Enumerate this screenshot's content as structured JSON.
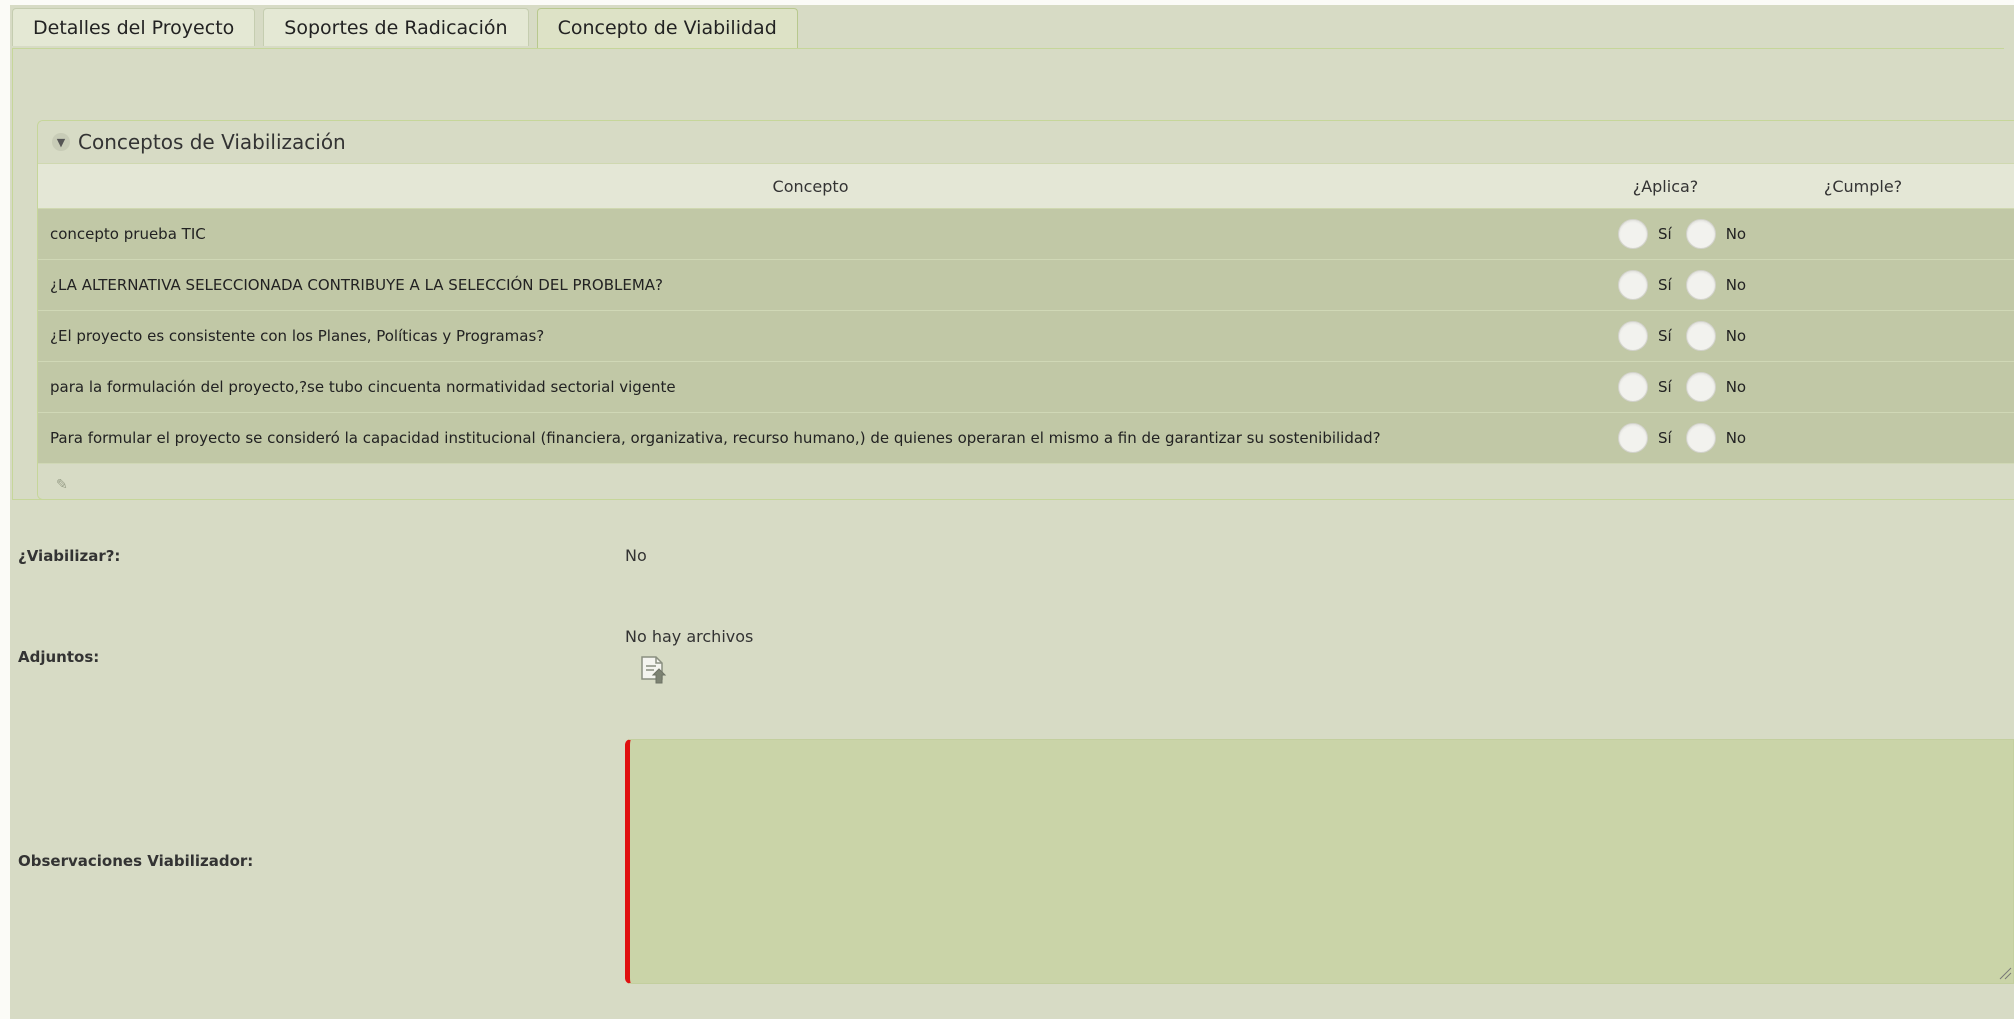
{
  "tabs": [
    {
      "label": "Detalles del Proyecto",
      "active": false
    },
    {
      "label": "Soportes de Radicación",
      "active": false
    },
    {
      "label": "Concepto de Viabilidad",
      "active": true
    }
  ],
  "accordion": {
    "title": "Conceptos de Viabilización",
    "columns": {
      "concept": "Concepto",
      "aplica": "¿Aplica?",
      "cumple": "¿Cumple?"
    },
    "rows": [
      {
        "text": "concepto prueba TIC",
        "yes": "Sí",
        "no": "No"
      },
      {
        "text": "¿LA ALTERNATIVA SELECCIONADA CONTRIBUYE A LA SELECCIÓN DEL PROBLEMA?",
        "yes": "Sí",
        "no": "No"
      },
      {
        "text": "¿El proyecto es consistente con los Planes, Políticas y Programas?",
        "yes": "Sí",
        "no": "No"
      },
      {
        "text": "para la formulación del proyecto,?se tubo cincuenta normatividad sectorial vigente",
        "yes": "Sí",
        "no": "No"
      },
      {
        "text": "Para formular el proyecto se consideró la capacidad institucional (financiera, organizativa, recurso humano,) de quienes operaran el mismo a fin de garantizar su sostenibilidad?",
        "yes": "Sí",
        "no": "No"
      }
    ]
  },
  "form": {
    "viabilizar_label": "¿Viabilizar?:",
    "viabilizar_value": "No",
    "adjuntos_label": "Adjuntos:",
    "adjuntos_value": "No hay archivos",
    "observaciones_label": "Observaciones Viabilizador:",
    "observaciones_value": ""
  },
  "icons": {
    "chevron": "chevron-down-icon",
    "edit": "pencil-icon",
    "upload": "upload-file-icon"
  },
  "colors": {
    "background": "#d7dbc5",
    "row_background": "#c1c8a6",
    "required_border": "#e01010",
    "textarea_background": "#cad4a8"
  }
}
